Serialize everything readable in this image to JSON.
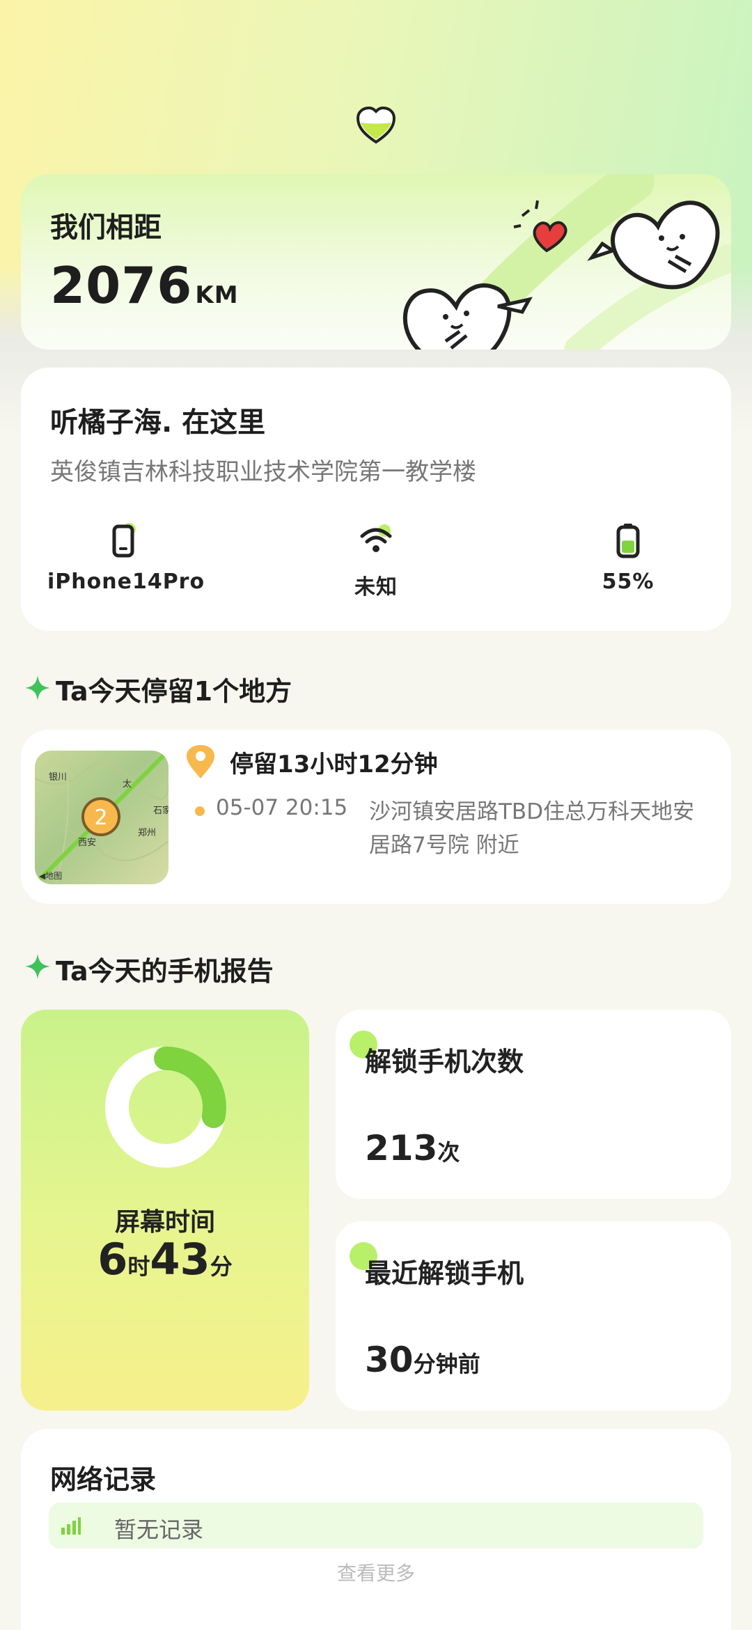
{
  "distance": {
    "title": "我们相距",
    "value": "2076",
    "unit": "KM"
  },
  "status": {
    "name": "听橘子海. 在这里",
    "address": "英俊镇吉林科技职业技术学院第一教学楼",
    "device": {
      "label": "iPhone14Pro",
      "icon": "phone-icon"
    },
    "wifi": {
      "label": "未知",
      "icon": "wifi-icon"
    },
    "battery": {
      "label": "55%",
      "level": 0.55,
      "icon": "battery-icon"
    }
  },
  "stay_section": {
    "title": "Ta今天停留1个地方"
  },
  "stay": {
    "duration": "停留13小时12分钟",
    "time": "05-07 20:15",
    "address": "沙河镇安居路TBD住总万科天地安居路7号院 附近",
    "map": {
      "marker_count": "2",
      "labels": [
        "银川",
        "太",
        "石家",
        "西安",
        "郑州",
        "◀地图"
      ]
    }
  },
  "report_section": {
    "title": "Ta今天的手机报告"
  },
  "screen_time": {
    "label": "屏幕时间",
    "hours": "6",
    "hours_unit": "时",
    "minutes": "43",
    "minutes_unit": "分",
    "ring_fraction": 0.28
  },
  "unlock_count": {
    "title": "解锁手机次数",
    "value": "213",
    "unit": "次"
  },
  "last_unlock": {
    "title": "最近解锁手机",
    "value": "30",
    "unit": "分钟前"
  },
  "network": {
    "title": "网络记录",
    "empty_text": "暂无记录",
    "more_label": "查看更多"
  },
  "colors": {
    "accent_green": "#7ed33f",
    "marker_orange": "#f7b94d",
    "light_green": "#b8f06a"
  }
}
